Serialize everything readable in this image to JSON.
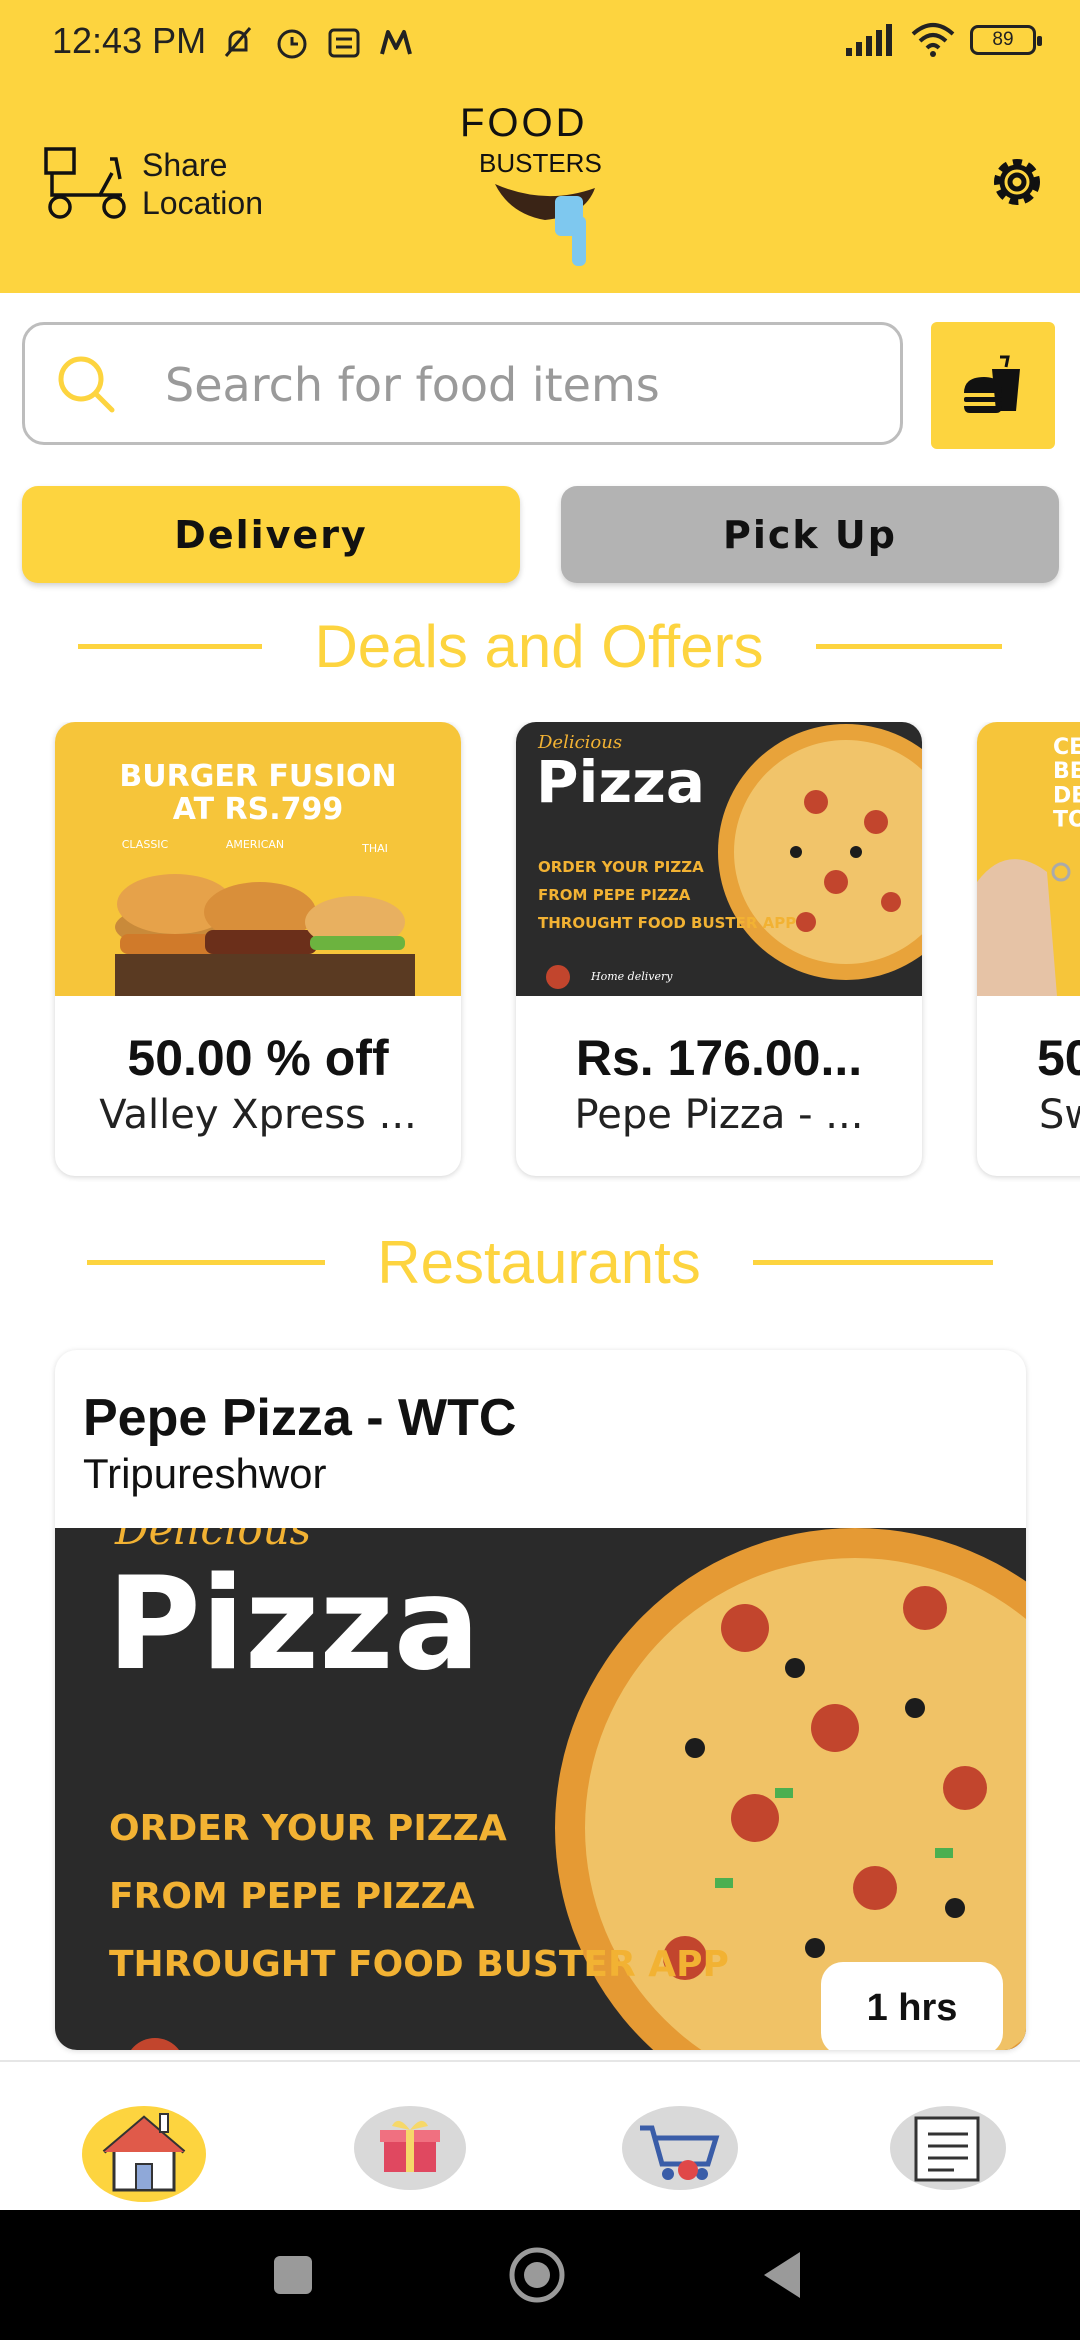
{
  "status_bar": {
    "time": "12:43 PM",
    "battery": "89"
  },
  "header": {
    "share_location_label": "Share\nLocation",
    "logo_line1": "FOOD",
    "logo_line2": "BUSTERS"
  },
  "search": {
    "placeholder": "Search for food items"
  },
  "order_mode": {
    "delivery_label": "Delivery",
    "pickup_label": "Pick Up",
    "selected": "Delivery"
  },
  "deals": {
    "title": "Deals and Offers",
    "items": [
      {
        "value": "50.00 % off",
        "restaurant": "Valley Xpress ...",
        "image_text": "BURGER FUSION\nAT RS.799",
        "image_sublabels": [
          "CLASSIC",
          "AMERICAN",
          "THAI"
        ]
      },
      {
        "value": "Rs. 176.00...",
        "restaurant": "Pepe Pizza - ...",
        "image_script": "Delicious",
        "image_title": "Pizza",
        "image_lines": [
          "ORDER YOUR PIZZA",
          "FROM PEPE PIZZA",
          "THROUGHT FOOD BUSTER APP"
        ],
        "image_footer": "Home delivery"
      },
      {
        "value": "50",
        "restaurant": "Sw",
        "image_text": "CE\nBE\nDE\nTO"
      }
    ]
  },
  "restaurants": {
    "title": "Restaurants",
    "items": [
      {
        "name": "Pepe Pizza - WTC",
        "location": "Tripureshwor",
        "time": "1 hrs",
        "image_script": "Delicious",
        "image_title": "Pizza",
        "image_lines": [
          "ORDER YOUR PIZZA",
          "FROM PEPE PIZZA",
          "THROUGHT FOOD BUSTER APP"
        ]
      }
    ]
  },
  "bottom_nav": {
    "items": [
      {
        "icon": "home-icon"
      },
      {
        "icon": "gift-icon"
      },
      {
        "icon": "cart-icon"
      },
      {
        "icon": "orders-list-icon"
      }
    ]
  },
  "colors": {
    "brand_yellow": "#fdd43f",
    "pickup_gray": "#b3b3b3"
  }
}
